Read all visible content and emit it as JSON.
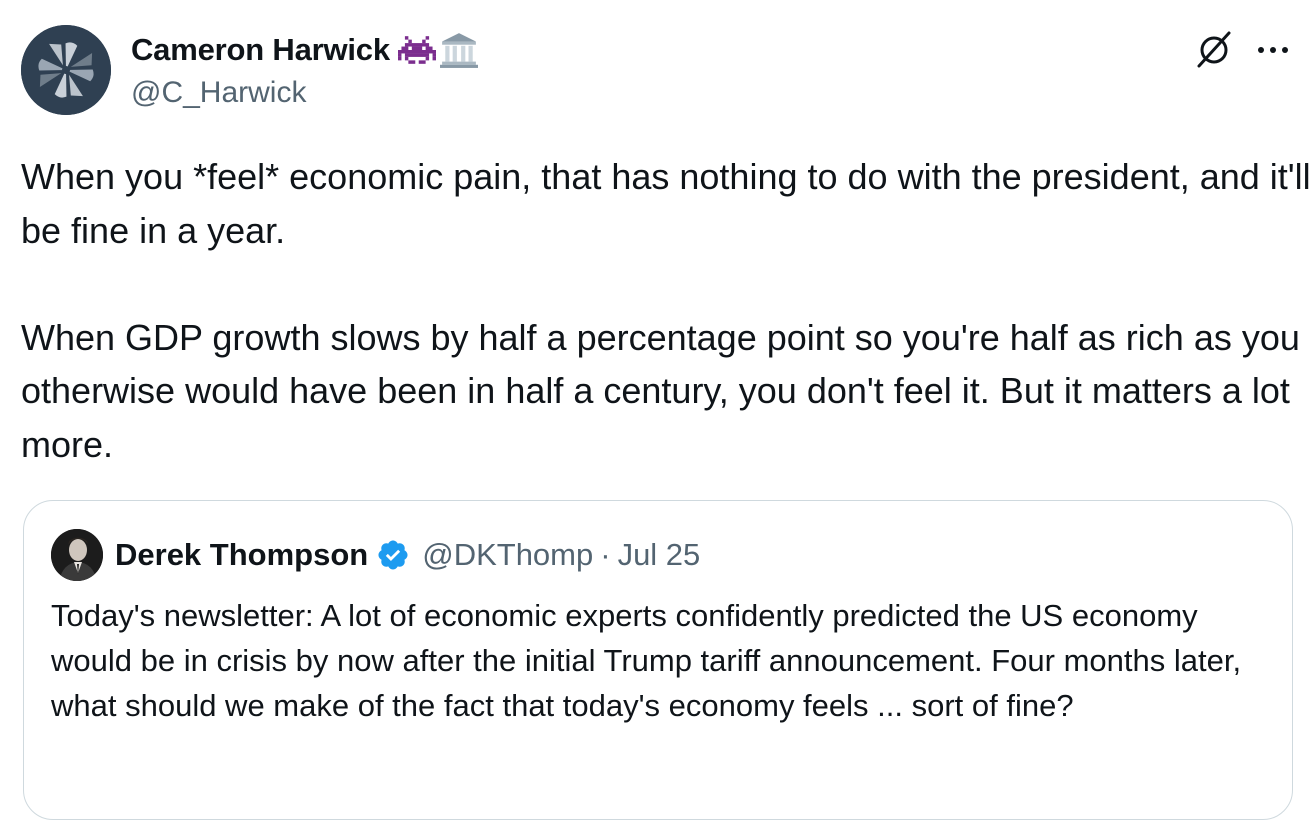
{
  "tweet": {
    "author": {
      "display_name": "Cameron Harwick",
      "name_emojis": [
        "space-invader-emoji",
        "classical-building-emoji"
      ],
      "handle": "@C_Harwick",
      "avatar_icon": "pinwheel-avatar"
    },
    "actions": {
      "grok_icon": "grok-icon",
      "more_icon": "more-icon"
    },
    "text": "When you *feel* economic pain, that has nothing to do with the president, and it'll be fine in a year.\n\nWhen GDP growth slows by half a percentage point so you're half as rich as you otherwise would have been in half a century, you don't feel it. But it matters a lot more."
  },
  "quoted_tweet": {
    "author": {
      "display_name": "Derek Thompson",
      "verified_icon": "verified-badge-icon",
      "handle": "@DKThomp",
      "separator": "·",
      "date": "Jul 25"
    },
    "text": "Today's newsletter: A lot of economic experts confidently predicted the US economy would be in crisis by now after the initial Trump tariff announcement. Four months later, what should we make of the fact that today's economy feels ... sort of fine?"
  },
  "colors": {
    "text_primary": "#0f1419",
    "text_secondary": "#536471",
    "border": "#cfd9de",
    "verified_blue": "#1d9bf0",
    "avatar_bg": "#2f4052"
  }
}
